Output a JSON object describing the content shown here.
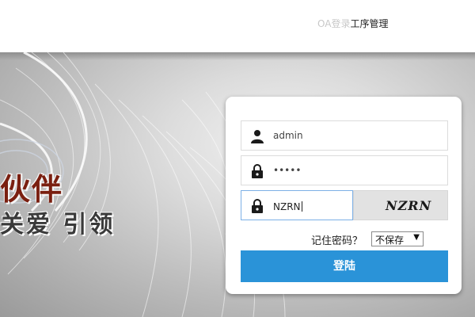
{
  "header": {
    "title_faded": "OA登录",
    "title": "工序管理"
  },
  "banner": {
    "slogan_line1": "伙伴",
    "slogan_line2": "关爱  引领"
  },
  "login": {
    "username_value": "admin",
    "password_value": "•••••",
    "captcha_value": "NZRN",
    "captcha_image_text": "NZRN",
    "remember_label": "记住密码？",
    "remember_options": [
      "不保存"
    ],
    "remember_selected": "不保存",
    "submit_label": "登陆"
  },
  "icons": {
    "user": "user-icon",
    "lock": "lock-icon",
    "dropdown": "chevron-down-icon"
  },
  "colors": {
    "primary_button": "#2a93d8",
    "slogan_red": "#7a1f10",
    "focus_border": "#7cb0e6"
  }
}
